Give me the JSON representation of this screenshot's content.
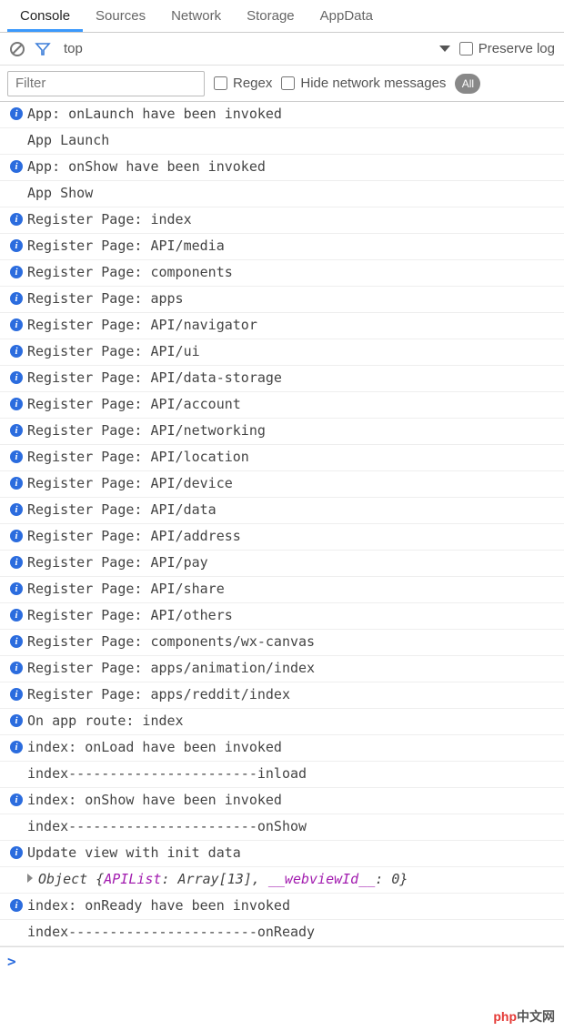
{
  "tabs": [
    {
      "label": "Console",
      "active": true
    },
    {
      "label": "Sources"
    },
    {
      "label": "Network"
    },
    {
      "label": "Storage"
    },
    {
      "label": "AppData"
    }
  ],
  "toolbar": {
    "context": "top",
    "preserve_log": "Preserve log"
  },
  "filter": {
    "placeholder": "Filter",
    "regex": "Regex",
    "hide_network": "Hide network messages",
    "all": "All"
  },
  "log_rows": [
    {
      "type": "info",
      "text": "App: onLaunch have been invoked"
    },
    {
      "type": "log",
      "text": "App Launch"
    },
    {
      "type": "info",
      "text": "App: onShow have been invoked"
    },
    {
      "type": "log",
      "text": "App Show"
    },
    {
      "type": "info",
      "text": "Register Page: index"
    },
    {
      "type": "info",
      "text": "Register Page: API/media"
    },
    {
      "type": "info",
      "text": "Register Page: components"
    },
    {
      "type": "info",
      "text": "Register Page: apps"
    },
    {
      "type": "info",
      "text": "Register Page: API/navigator"
    },
    {
      "type": "info",
      "text": "Register Page: API/ui"
    },
    {
      "type": "info",
      "text": "Register Page: API/data-storage"
    },
    {
      "type": "info",
      "text": "Register Page: API/account"
    },
    {
      "type": "info",
      "text": "Register Page: API/networking"
    },
    {
      "type": "info",
      "text": "Register Page: API/location"
    },
    {
      "type": "info",
      "text": "Register Page: API/device"
    },
    {
      "type": "info",
      "text": "Register Page: API/data"
    },
    {
      "type": "info",
      "text": "Register Page: API/address"
    },
    {
      "type": "info",
      "text": "Register Page: API/pay"
    },
    {
      "type": "info",
      "text": "Register Page: API/share"
    },
    {
      "type": "info",
      "text": "Register Page: API/others"
    },
    {
      "type": "info",
      "text": "Register Page: components/wx-canvas"
    },
    {
      "type": "info",
      "text": "Register Page: apps/animation/index"
    },
    {
      "type": "info",
      "text": "Register Page: apps/reddit/index"
    },
    {
      "type": "info",
      "text": "On app route: index"
    },
    {
      "type": "info",
      "text": "index: onLoad have been invoked"
    },
    {
      "type": "log",
      "text": "index-----------------------inload"
    },
    {
      "type": "info",
      "text": "index: onShow have been invoked"
    },
    {
      "type": "log",
      "text": "index-----------------------onShow"
    },
    {
      "type": "info",
      "text": "Update view with init data"
    },
    {
      "type": "object",
      "prefix": "Object {",
      "k1": "APIList",
      "v1": ": Array[13], ",
      "k2": "__webviewId__",
      "v2": ": 0",
      "suffix": "}"
    },
    {
      "type": "info",
      "text": "index: onReady have been invoked"
    },
    {
      "type": "log",
      "text": "index-----------------------onReady"
    }
  ],
  "footer": {
    "p1": "php",
    "p2": "中文网"
  }
}
